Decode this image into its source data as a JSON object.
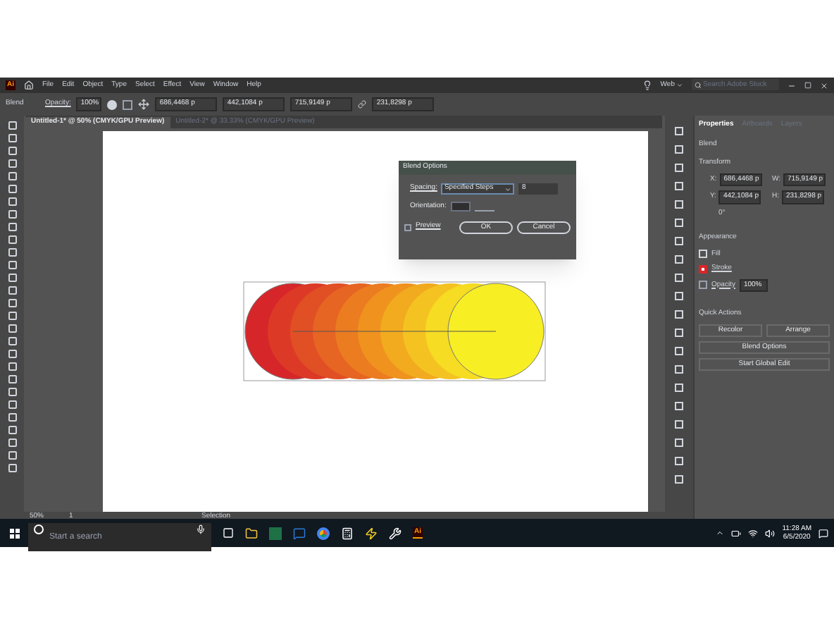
{
  "app_logo": "Ai",
  "menu": [
    "File",
    "Edit",
    "Object",
    "Type",
    "Select",
    "Effect",
    "View",
    "Window",
    "Help"
  ],
  "workspace": "Web",
  "search": {
    "placeholder": "Search Adobe Stock"
  },
  "control_bar": {
    "label": "Blend",
    "opacity_label": "Opacity:",
    "opacity": "100%",
    "x": "686,4468 p",
    "y": "442,1084 p",
    "w": "715,9149 p",
    "h": "231,8298 p"
  },
  "doc_tabs": [
    {
      "label": "Untitled-1* @ 50% (CMYK/GPU Preview)",
      "selected": true
    },
    {
      "label": "Untitled-2* @ 33.33% (CMYK/GPU Preview)",
      "selected": false
    }
  ],
  "dialog": {
    "title": "Blend Options",
    "spacing_label": "Spacing:",
    "spacing": "Specified Steps",
    "steps": "8",
    "orientation_label": "Orientation:",
    "preview": {
      "label": "Preview",
      "checked": false
    },
    "buttons": [
      "OK",
      "Cancel"
    ]
  },
  "panel": {
    "tabs": [
      {
        "label": "Properties",
        "selected": true
      },
      {
        "label": "Artboards",
        "selected": false
      },
      {
        "label": "Layers",
        "selected": false
      }
    ],
    "object": "Blend",
    "transform_title": "Transform",
    "fields": [
      {
        "label": "X:",
        "value": "686,4468 p"
      },
      {
        "label": "W:",
        "value": "715,9149 p"
      },
      {
        "label": "Y:",
        "value": "442,1084 p"
      },
      {
        "label": "H:",
        "value": "231,8298 p"
      }
    ],
    "angle": "0°",
    "appearance_title": "Appearance",
    "fill": "Fill",
    "stroke": "Stroke",
    "opacity_label": "Opacity",
    "opacity": "100%",
    "quick_actions_title": "Quick Actions",
    "buttons": [
      "Recolor",
      "Arrange",
      "Blend Options",
      "Start Global Edit"
    ]
  },
  "status": {
    "zoom": "50%",
    "page": "1",
    "tool": "Selection"
  },
  "taskbar": {
    "search": {
      "placeholder": "Start a search"
    },
    "app_logo": "Ai",
    "time": "11:28 AM",
    "date": "6/5/2020"
  }
}
